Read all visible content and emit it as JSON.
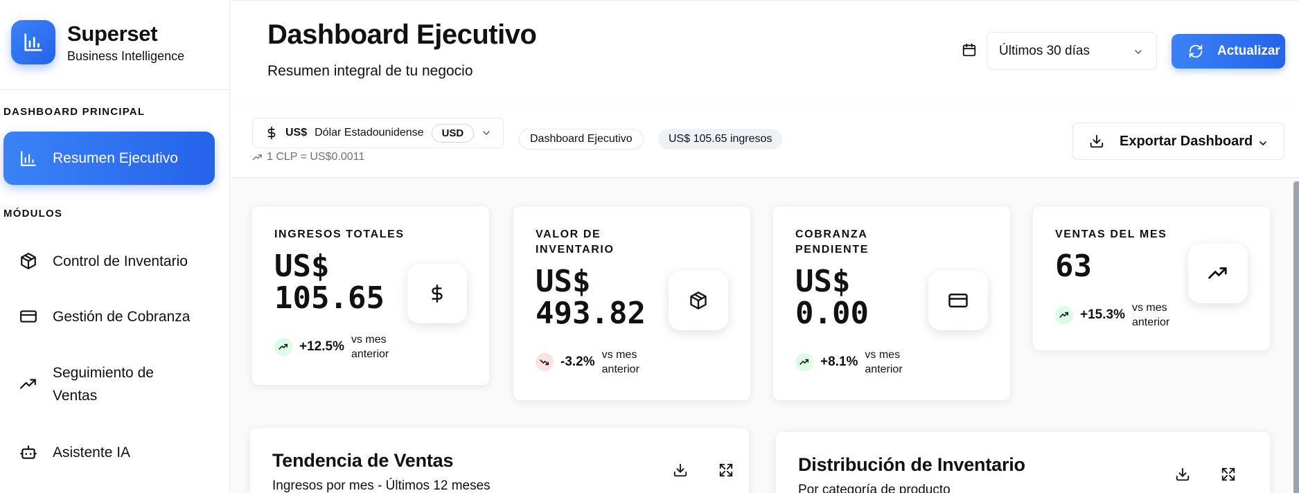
{
  "brand": {
    "name": "Superset",
    "subtitle": "Business Intelligence"
  },
  "sidebar": {
    "section_main": "DASHBOARD PRINCIPAL",
    "section_modules": "MÓDULOS",
    "items": [
      {
        "label": "Resumen Ejecutivo",
        "icon": "bar-chart-icon",
        "active": true
      },
      {
        "label": "Control de Inventario",
        "icon": "box-icon"
      },
      {
        "label": "Gestión de Cobranza",
        "icon": "credit-card-icon"
      },
      {
        "label": "Seguimiento de Ventas",
        "icon": "trending-up-icon"
      },
      {
        "label": "Asistente IA",
        "icon": "bot-icon"
      }
    ]
  },
  "header": {
    "title": "Dashboard Ejecutivo",
    "subtitle": "Resumen integral de tu negocio",
    "date_range": "Últimos 30 días",
    "refresh_label": "Actualizar"
  },
  "currency": {
    "symbol": "US$",
    "name": "Dólar Estadounidense",
    "code": "USD",
    "rate": "1 CLP = US$0.0011"
  },
  "chips": [
    "Dashboard Ejecutivo",
    "US$ 105.65 ingresos"
  ],
  "export_label": "Exportar Dashboard",
  "kpis": [
    {
      "label": "INGRESOS TOTALES",
      "value": "US$\n105.65",
      "change": "+12.5%",
      "trend": "up",
      "vs": "vs mes anterior",
      "icon": "dollar-icon"
    },
    {
      "label": "VALOR DE INVENTARIO",
      "value": "US$\n493.82",
      "change": "-3.2%",
      "trend": "down",
      "vs": "vs mes anterior",
      "icon": "box-icon"
    },
    {
      "label": "COBRANZA PENDIENTE",
      "value": "US$\n0.00",
      "change": "+8.1%",
      "trend": "up",
      "vs": "vs mes anterior",
      "icon": "credit-card-icon"
    },
    {
      "label": "VENTAS DEL MES",
      "value": "63",
      "change": "+15.3%",
      "trend": "up",
      "vs": "vs mes anterior",
      "icon": "trending-up-icon"
    }
  ],
  "panels": [
    {
      "title": "Tendencia de Ventas",
      "subtitle": "Ingresos por mes - Últimos 12 meses"
    },
    {
      "title": "Distribución de Inventario",
      "subtitle": "Por categoría de producto"
    }
  ],
  "colors": {
    "accent": "#2563eb",
    "up_bg": "#dcfce7",
    "down_bg": "#fee2e2"
  }
}
